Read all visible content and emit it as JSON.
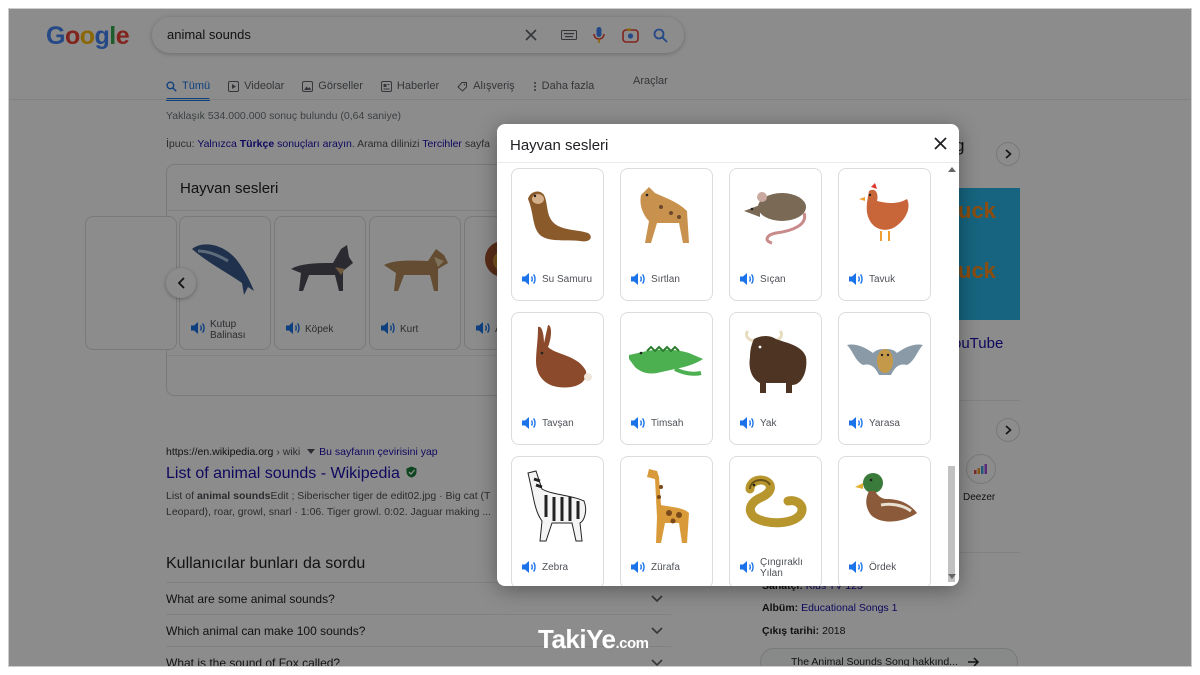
{
  "logo": {
    "text": "Google"
  },
  "search": {
    "query": "animal sounds"
  },
  "icons": {
    "clear": "close-icon",
    "keyboard": "keyboard-icon",
    "voice": "mic-icon",
    "lens": "camera-icon",
    "search": "search-icon"
  },
  "tabs": [
    {
      "label": "Tümü",
      "icon": "search-icon",
      "active": true
    },
    {
      "label": "Videolar",
      "icon": "play-icon"
    },
    {
      "label": "Görseller",
      "icon": "image-icon"
    },
    {
      "label": "Haberler",
      "icon": "news-icon"
    },
    {
      "label": "Alışveriş",
      "icon": "tag-icon"
    },
    {
      "label": "Daha fazla",
      "icon": "more-icon"
    }
  ],
  "tools_label": "Araçlar",
  "stats": "Yaklaşık 534.000.000 sonuç bulundu (0,64 saniye)",
  "tip": {
    "prefix": "İpucu: ",
    "link1a": "Yalnızca ",
    "link1b": "Türkçe",
    "link1c": " sonuçları arayın",
    "mid": ". Arama dilinizi ",
    "link2": "Tercihler",
    "suffix": " sayfa"
  },
  "background_card": {
    "title": "Hayvan sesleri",
    "tiles": [
      {
        "label": "Kutup Balinası"
      },
      {
        "label": "Köpek"
      },
      {
        "label": "Kurt"
      },
      {
        "label": "A"
      }
    ]
  },
  "result": {
    "url": "https://en.wikipedia.org",
    "crumb": " › wiki",
    "translate": "Bu sayfanın çevirisini yap",
    "title": "List of animal sounds - Wikipedia",
    "snippet_pre": "List of ",
    "snippet_bold": "animal sounds",
    "snippet_line1": "Edit ; Siberischer tiger de edit02.jpg · Big cat (T",
    "snippet_line2": "Leopard), roar, growl, snarl · 1:06. Tiger growl. 0:02. Jaguar making ..."
  },
  "paa": {
    "title": "Kullanıcılar bunları da sordu",
    "questions": [
      "What are some animal sounds?",
      "Which animal can make 100 sounds?",
      "What is the sound of Fox called?"
    ]
  },
  "right_panel": {
    "title_fragment": "g",
    "youtube_fragment": "ouTube",
    "thumb_text_top": "uck",
    "thumb_text_bottom": "uck",
    "deezer": "Deezer",
    "artist_label": "Sanatçı:",
    "artist_value": "Kids TV 123",
    "album_label": "Albüm:",
    "album_value": "Educational Songs 1",
    "release_label": "Çıkış tarihi:",
    "release_value": "2018",
    "pill": "The Animal Sounds Song hakkınd..."
  },
  "modal": {
    "title": "Hayvan sesleri",
    "animals": [
      {
        "label": "Su Samuru",
        "icon": "otter-icon",
        "color": "#8b5a2b"
      },
      {
        "label": "Sırtlan",
        "icon": "hyena-icon",
        "color": "#c8924e"
      },
      {
        "label": "Sıçan",
        "icon": "rat-icon",
        "color": "#7a6a55"
      },
      {
        "label": "Tavuk",
        "icon": "chicken-icon",
        "color": "#c8663a"
      },
      {
        "label": "Tavşan",
        "icon": "rabbit-icon",
        "color": "#8b4a2b"
      },
      {
        "label": "Timsah",
        "icon": "crocodile-icon",
        "color": "#4caf50"
      },
      {
        "label": "Yak",
        "icon": "yak-icon",
        "color": "#4e3422"
      },
      {
        "label": "Yarasa",
        "icon": "bat-icon",
        "color": "#8a9aa6"
      },
      {
        "label": "Zebra",
        "icon": "zebra-icon",
        "color": "#222222"
      },
      {
        "label": "Zürafa",
        "icon": "giraffe-icon",
        "color": "#d99a3a"
      },
      {
        "label": "Çıngıraklı Yılan",
        "icon": "rattlesnake-icon",
        "color": "#b8962e"
      },
      {
        "label": "Ördek",
        "icon": "duck-icon",
        "color": "#3a7a3a"
      }
    ]
  },
  "watermark": {
    "main": "TakiYe",
    "suffix": ".com"
  },
  "colors": {
    "accent": "#1a73e8",
    "link": "#1a0dab",
    "speaker": "#1a73e8"
  }
}
